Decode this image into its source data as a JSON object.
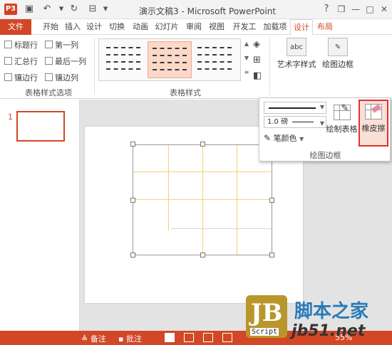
{
  "titlebar": {
    "app_icon": "P3",
    "qat": [
      "save-icon",
      "undo-icon",
      "redo-icon",
      "slideshow-icon"
    ],
    "title": "演示文稿3 - Microsoft PowerPoint",
    "help": "?",
    "window_controls": [
      "restore-icon",
      "minimize-icon",
      "maximize-icon",
      "close-icon"
    ]
  },
  "tabs": [
    "文件",
    "开始",
    "插入",
    "设计",
    "切换",
    "动画",
    "幻灯片",
    "审阅",
    "视图",
    "开发工",
    "加载项",
    "设计",
    "布局"
  ],
  "ribbon": {
    "options": {
      "left": [
        "标题行",
        "汇总行",
        "镶边行"
      ],
      "right": [
        "第一列",
        "最后一列",
        "镶边列"
      ],
      "label": "表格样式选项"
    },
    "styles": {
      "label": "表格样式"
    },
    "art_text": {
      "label": "艺术字样式",
      "icon_text": "abc"
    },
    "draw_borders": {
      "label": "绘图边框"
    }
  },
  "draw_panel": {
    "pen_weight": "1.0 磅",
    "pen_color": "笔颜色",
    "draw_table": "绘制表格",
    "eraser": "橡皮擦",
    "label": "绘图边框",
    "accent": "#e03030"
  },
  "thumbs": {
    "slide_number": "1"
  },
  "statusbar": {
    "notes": "备注",
    "comments": "批注",
    "zoom": "55%",
    "color": "#d24726"
  },
  "watermark": {
    "logo": "JB",
    "sub": "Script",
    "cn": "脚本之家",
    "url": "jb51.net"
  }
}
